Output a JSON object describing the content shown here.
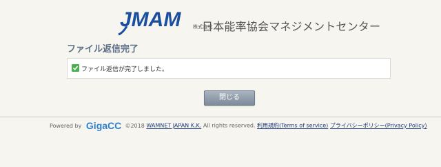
{
  "header": {
    "logo_text": "JMAM",
    "company_prefix": "株式会社",
    "company_name": "日本能率協会マネジメントセンター"
  },
  "page_title": "ファイル返信完了",
  "message": "ファイル返信が完了しました。",
  "close_button_label": "閉じる",
  "footer": {
    "powered_by": "Powered by",
    "gigacc_logo": "GigaCC",
    "copyright_prefix": "©2018 ",
    "company_link": "WAMNET JAPAN K.K.",
    "rights": " All rights reserved. ",
    "terms_link": "利用規約(Terms of service)",
    "privacy_link": "プライバシーポリシー(Privacy Policy)"
  },
  "colors": {
    "background": "#f6f5f0",
    "title": "#5c6e86",
    "brand_blue": "#1b4f9e",
    "check_green": "#4caf50",
    "button": "#8a97a7"
  }
}
